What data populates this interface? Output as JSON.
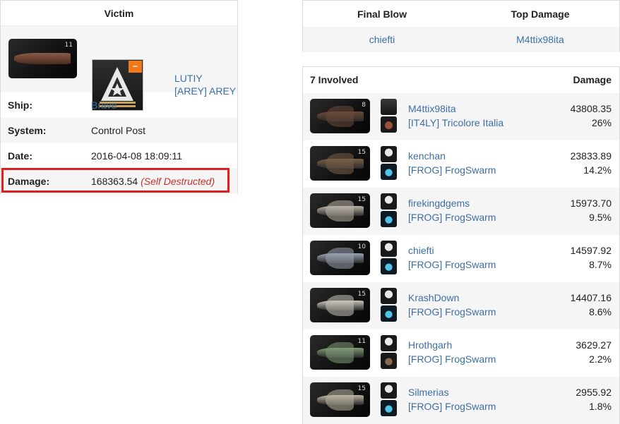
{
  "victim": {
    "title": "Victim",
    "pilot": "LUTIY",
    "corp": "[AREY] AREY",
    "ship_tier": "11",
    "corp_badge": "–",
    "fields": [
      {
        "label": "Ship:",
        "value": "Brave"
      },
      {
        "label": "System:",
        "value": "Control Post"
      },
      {
        "label": "Date:",
        "value": "2016-04-08 18:09:11"
      },
      {
        "label": "Damage:",
        "value": "168363.54",
        "note": "(Self Destructed)"
      }
    ]
  },
  "final_blow": {
    "col1": "Final Blow",
    "col2": "Top Damage",
    "final_blow_pilot": "chiefti",
    "top_damage_pilot": "M4ttix98ita"
  },
  "involved": {
    "title": "7 Involved",
    "damage_header": "Damage",
    "rows": [
      {
        "name": "M4ttix98ita",
        "corp": "[IT4LY] Tricolore Italia",
        "damage": "43808.35",
        "pct": "26%",
        "tier": "8",
        "hull": "#6b4a3a",
        "ally_icon": "triangle-star",
        "corp_icon": "ship-red"
      },
      {
        "name": "kenchan",
        "corp": "[FROG] FrogSwarm",
        "damage": "23833.89",
        "pct": "14.2%",
        "tier": "15",
        "hull": "#7a6048",
        "ally_icon": "laurel-skull",
        "corp_icon": "cyan-ship"
      },
      {
        "name": "firekingdgems",
        "corp": "[FROG] FrogSwarm",
        "damage": "15973.70",
        "pct": "9.5%",
        "tier": "15",
        "hull": "#b9b3a6",
        "ally_icon": "laurel-skull",
        "corp_icon": "cyan-ship"
      },
      {
        "name": "chiefti",
        "corp": "[FROG] FrogSwarm",
        "damage": "14597.92",
        "pct": "8.7%",
        "tier": "10",
        "hull": "#9aa3b3",
        "ally_icon": "laurel-skull",
        "corp_icon": "cyan-ship"
      },
      {
        "name": "KrashDown",
        "corp": "[FROG] FrogSwarm",
        "damage": "14407.16",
        "pct": "8.6%",
        "tier": "15",
        "hull": "#c9c4bc",
        "ally_icon": "laurel-skull",
        "corp_icon": "cyan-ship"
      },
      {
        "name": "Hrothgarh",
        "corp": "[FROG] FrogSwarm",
        "damage": "3629.27",
        "pct": "2.2%",
        "tier": "11",
        "hull": "#7f9a76",
        "ally_icon": "laurel-skull",
        "corp_icon": "brown-ship"
      },
      {
        "name": "Silmerias",
        "corp": "[FROG] FrogSwarm",
        "damage": "2955.92",
        "pct": "1.8%",
        "tier": "15",
        "hull": "#bdb4a3",
        "ally_icon": "laurel-skull",
        "corp_icon": "cyan-ship"
      }
    ]
  },
  "colors": {
    "link": "#3d6fa6",
    "self_destructed": "#c8302c",
    "highlight_border": "#e02020",
    "badge": "#f07a1a"
  }
}
